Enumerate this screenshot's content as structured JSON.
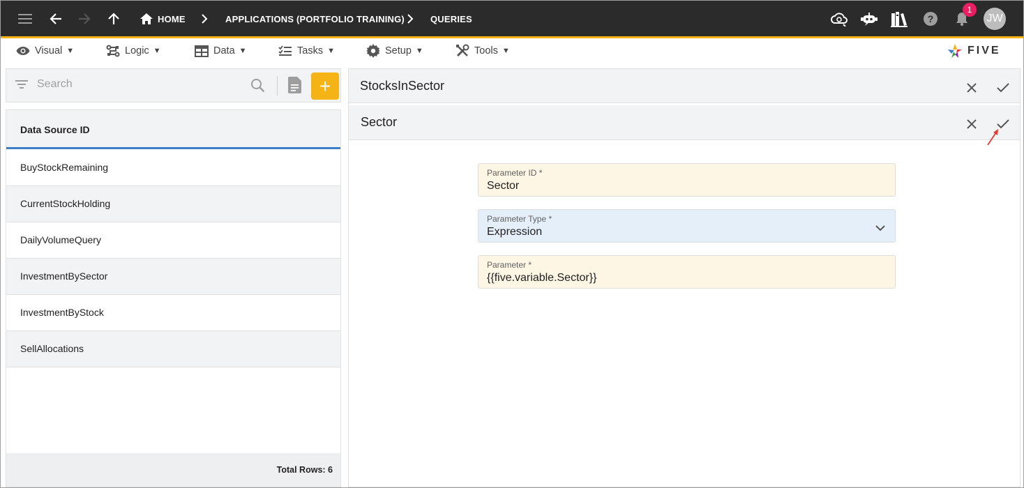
{
  "topbar": {
    "breadcrumb": {
      "home": "HOME",
      "applications": "APPLICATIONS (PORTFOLIO TRAINING)",
      "queries": "QUERIES"
    },
    "icons": [
      "menu-icon",
      "back-arrow-icon",
      "forward-arrow-icon",
      "up-arrow-icon",
      "home-icon",
      "chevron-right-icon",
      "cloud-sync-icon",
      "chat-bot-icon",
      "library-books-icon",
      "help-icon",
      "bell-icon"
    ],
    "notification_count": "1",
    "avatar_initials": "JW"
  },
  "menubar": {
    "items": [
      {
        "label": "Visual",
        "icon": "eye-icon"
      },
      {
        "label": "Logic",
        "icon": "logic-flow-icon"
      },
      {
        "label": "Data",
        "icon": "table-icon"
      },
      {
        "label": "Tasks",
        "icon": "checklist-icon"
      },
      {
        "label": "Setup",
        "icon": "gear-icon"
      },
      {
        "label": "Tools",
        "icon": "tools-icon"
      }
    ],
    "caret": "▼",
    "brand": "FIVE"
  },
  "search": {
    "placeholder": "Search",
    "add_label": "+"
  },
  "list": {
    "header": "Data Source ID",
    "rows": [
      "BuyStockRemaining",
      "CurrentStockHolding",
      "DailyVolumeQuery",
      "InvestmentBySector",
      "InvestmentByStock",
      "SellAllocations"
    ],
    "footer": "Total Rows: 6"
  },
  "detail": {
    "outer_title": "StocksInSector",
    "inner_title": "Sector",
    "fields": [
      {
        "label": "Parameter ID *",
        "value": "Sector"
      },
      {
        "label": "Parameter Type *",
        "value": "Expression"
      },
      {
        "label": "Parameter *",
        "value": "{{five.variable.Sector}}"
      }
    ]
  },
  "colors": {
    "topbar_bg": "#2b2b2b",
    "accent": "#f5b316",
    "list_header_underline": "#3d7ec8",
    "badge": "#e91e63",
    "field_yellow": "#fef6e4",
    "field_blue": "#e5eff9"
  }
}
